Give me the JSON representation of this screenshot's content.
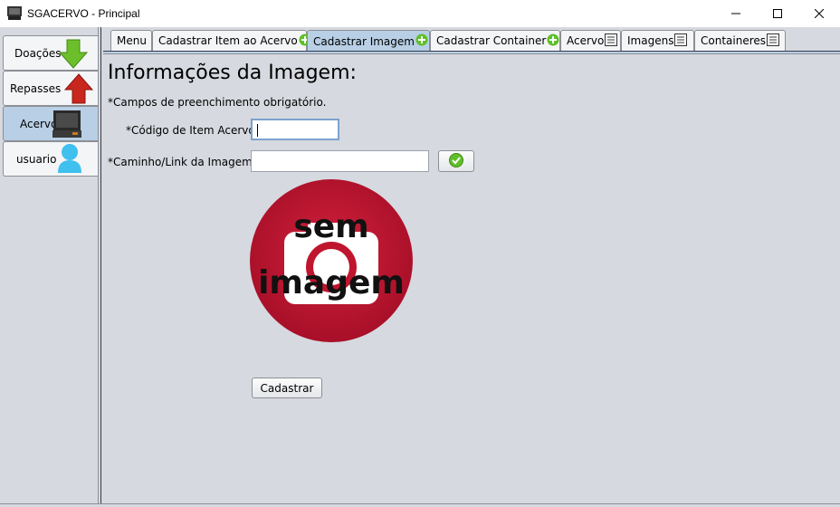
{
  "window": {
    "title": "SGACERVO - Principal",
    "app_icon": "computer-monitor-icon"
  },
  "side_tabs": [
    {
      "label": "Doações",
      "icon": "green-down-arrow-icon"
    },
    {
      "label": "Repasses",
      "icon": "red-up-arrow-icon"
    },
    {
      "label": "Acervo",
      "icon": "computer-icon",
      "selected": true
    },
    {
      "label": "usuario",
      "icon": "user-icon"
    }
  ],
  "top_tabs": [
    {
      "label": "Menu",
      "icon": ""
    },
    {
      "label": "Cadastrar Item ao Acervo",
      "icon": "plus-icon"
    },
    {
      "label": "Cadastrar Imagem",
      "icon": "plus-icon",
      "selected": true
    },
    {
      "label": "Cadastrar Container",
      "icon": "plus-icon"
    },
    {
      "label": "Acervo",
      "icon": "list-icon"
    },
    {
      "label": "Imagens",
      "icon": "list-icon"
    },
    {
      "label": "Containeres",
      "icon": "list-icon"
    }
  ],
  "form": {
    "heading": "Informações da Imagem:",
    "required_note": "*Campos de preenchimento obrigatório.",
    "codigo_label": "*Código de Item Acervo:",
    "codigo_value": "",
    "caminho_label": "*Caminho/Link da Imagem:",
    "caminho_value": "",
    "confirm_icon": "green-check-icon",
    "placeholder_image_text_1": "sem",
    "placeholder_image_text_2": "imagem",
    "submit_label": "Cadastrar"
  },
  "colors": {
    "selected_tab": "#b8cfe5",
    "window_bg": "#d6d9df",
    "no_image_red": "#c0152f"
  }
}
